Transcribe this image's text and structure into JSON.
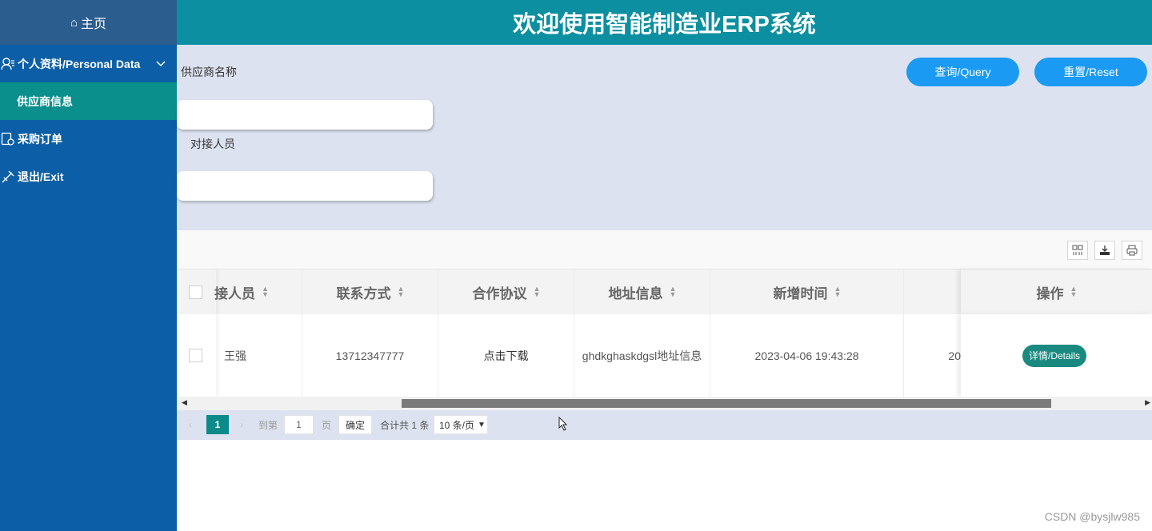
{
  "sidebar": {
    "home": "主页",
    "personal": "个人资料/Personal Data",
    "supplier": "供应商信息",
    "orders": "采购订单",
    "exit": "退出/Exit"
  },
  "header": {
    "title": "欢迎使用智能制造业ERP系统"
  },
  "search": {
    "supplier_label": "供应商名称",
    "contact_label": "对接人员",
    "query_button": "查询/Query",
    "reset_button": "重置/Reset"
  },
  "table": {
    "columns": [
      "接人员",
      "联系方式",
      "合作协议",
      "地址信息",
      "新增时间",
      "操作"
    ],
    "rows": [
      {
        "contact": "王强",
        "phone": "13712347777",
        "agreement": "点击下载",
        "address": "ghdkghaskdgsl地址信息",
        "created": "2023-04-06 19:43:28",
        "partial": "20",
        "action": "详情/Details"
      }
    ]
  },
  "pager": {
    "current": "1",
    "goto_label": "到第",
    "goto_value": "1",
    "page_label": "页",
    "confirm": "确定",
    "total": "合计共 1 条",
    "page_size": "10 条/页"
  },
  "watermark": "CSDN @bysjlw985"
}
